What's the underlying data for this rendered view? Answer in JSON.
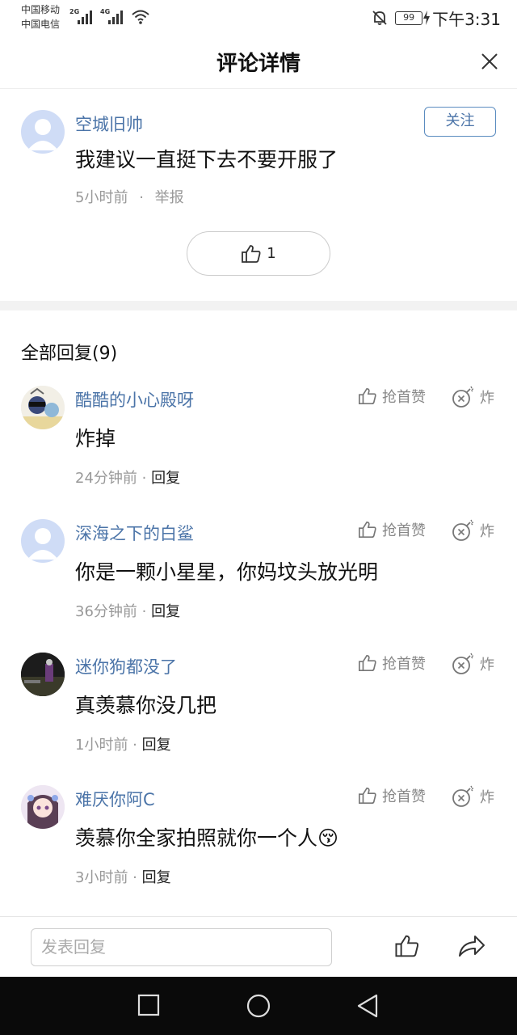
{
  "status": {
    "carrier1": "中国移动",
    "carrier2": "中国电信",
    "net1": "2G",
    "net2": "4G",
    "battery": "99",
    "time": "下午3:31"
  },
  "header": {
    "title": "评论详情"
  },
  "main_comment": {
    "username": "空城旧帅",
    "text": "我建议一直挺下去不要开服了",
    "time": "5小时前",
    "separator": "·",
    "report": "举报",
    "follow": "关注",
    "likes": "1"
  },
  "replies_section": {
    "title": "全部回复(9)"
  },
  "replies": [
    {
      "username": "酷酷的小心殿呀",
      "text": "炸掉",
      "time": "24分钟前 · ",
      "reply": "回复",
      "like": "抢首赞",
      "bomb": "炸"
    },
    {
      "username": "深海之下的白鲨",
      "text": "你是一颗小星星，你妈坟头放光明",
      "time": "36分钟前 · ",
      "reply": "回复",
      "like": "抢首赞",
      "bomb": "炸"
    },
    {
      "username": "迷你狗都没了",
      "text": "真羡慕你没几把",
      "time": "1小时前 · ",
      "reply": "回复",
      "like": "抢首赞",
      "bomb": "炸"
    },
    {
      "username": "难厌你阿C",
      "text": "羡慕你全家拍照就你一个人😚",
      "time": "3小时前 · ",
      "reply": "回复",
      "like": "抢首赞",
      "bomb": "炸"
    }
  ],
  "bottom_bar": {
    "input_placeholder": "发表回复"
  },
  "colors": {
    "accent": "#4b74a8",
    "meta": "#999999",
    "divider": "#f2f2f2"
  }
}
